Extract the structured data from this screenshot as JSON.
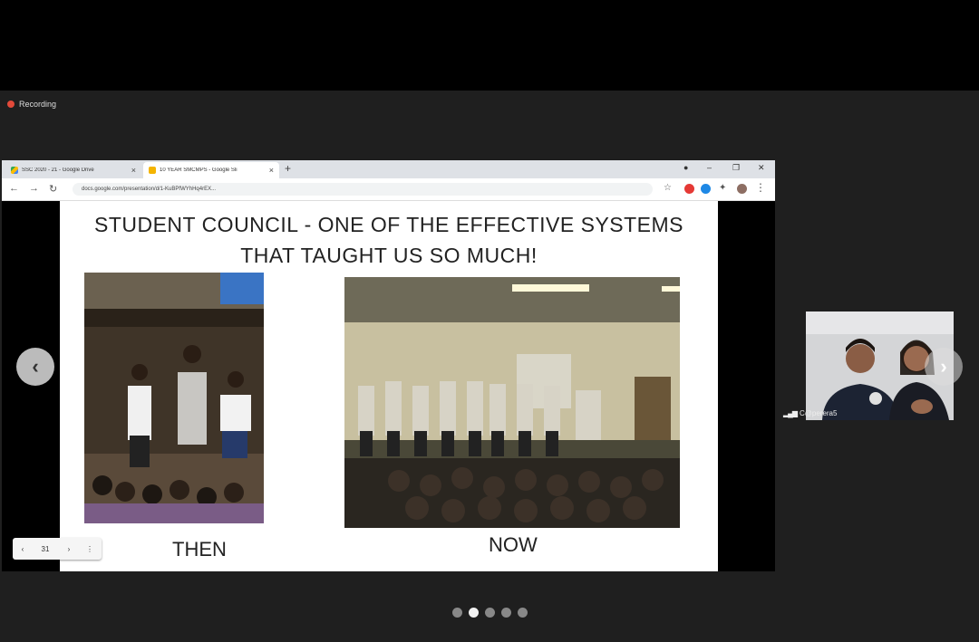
{
  "recording": {
    "label": "Recording"
  },
  "browser": {
    "tabs": [
      {
        "title": "SSC 2020 - 21 - Google Drive",
        "icon": "google-drive-icon",
        "active": false
      },
      {
        "title": "10 YEAR SMCMPS - Google Sli",
        "icon": "google-slides-icon",
        "active": true
      }
    ],
    "new_tab": "+",
    "url": "docs.google.com/presentation/d/1-KuBPfWYhHq4rEX...",
    "window_controls": {
      "minimize": "–",
      "maximize": "❐",
      "close": "✕"
    }
  },
  "slide": {
    "title_line1": "STUDENT COUNCIL - ONE OF THE EFFECTIVE SYSTEMS",
    "title_line2": "THAT TAUGHT US SO MUCH!",
    "caption_left": "THEN",
    "caption_right": "NOW",
    "page_number": "31"
  },
  "participant": {
    "name": "C@perera5"
  },
  "carousel": {
    "pages": 5,
    "active_index": 1
  },
  "colors": {
    "accent_red": "#e24a3a",
    "background": "#1f1f1f"
  }
}
